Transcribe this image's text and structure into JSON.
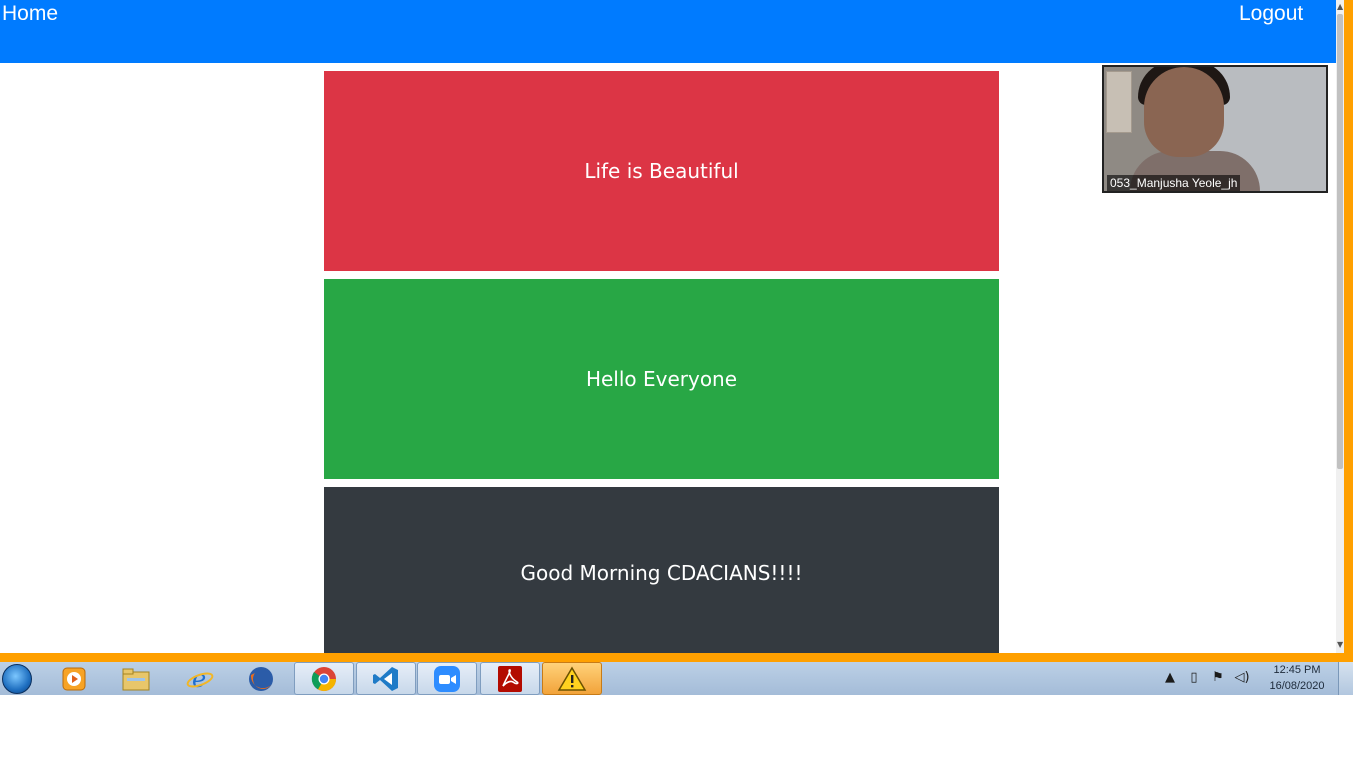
{
  "nav": {
    "home_label": "Home",
    "logout_label": "Logout",
    "bg_color": "#007bff"
  },
  "cards": [
    {
      "text": "Life is Beautiful",
      "color": "#dc3545"
    },
    {
      "text": "Hello Everyone",
      "color": "#28a745"
    },
    {
      "text": "Good Morning CDACIANS!!!!",
      "color": "#343a40"
    }
  ],
  "video": {
    "participant_name": "053_Manjusha Yeole_jh"
  },
  "taskbar": {
    "icons": [
      "start-orb-icon",
      "media-player-icon",
      "file-explorer-icon",
      "internet-explorer-icon",
      "firefox-icon",
      "chrome-icon",
      "visual-studio-code-icon",
      "zoom-icon",
      "adobe-reader-icon",
      "warning-icon"
    ],
    "tray_icons": [
      "show-hidden-icons-icon",
      "battery-icon",
      "action-center-flag-icon",
      "volume-icon"
    ],
    "clock_time": "12:45 PM",
    "clock_date": "16/08/2020"
  },
  "share_border_color": "#ffa000"
}
